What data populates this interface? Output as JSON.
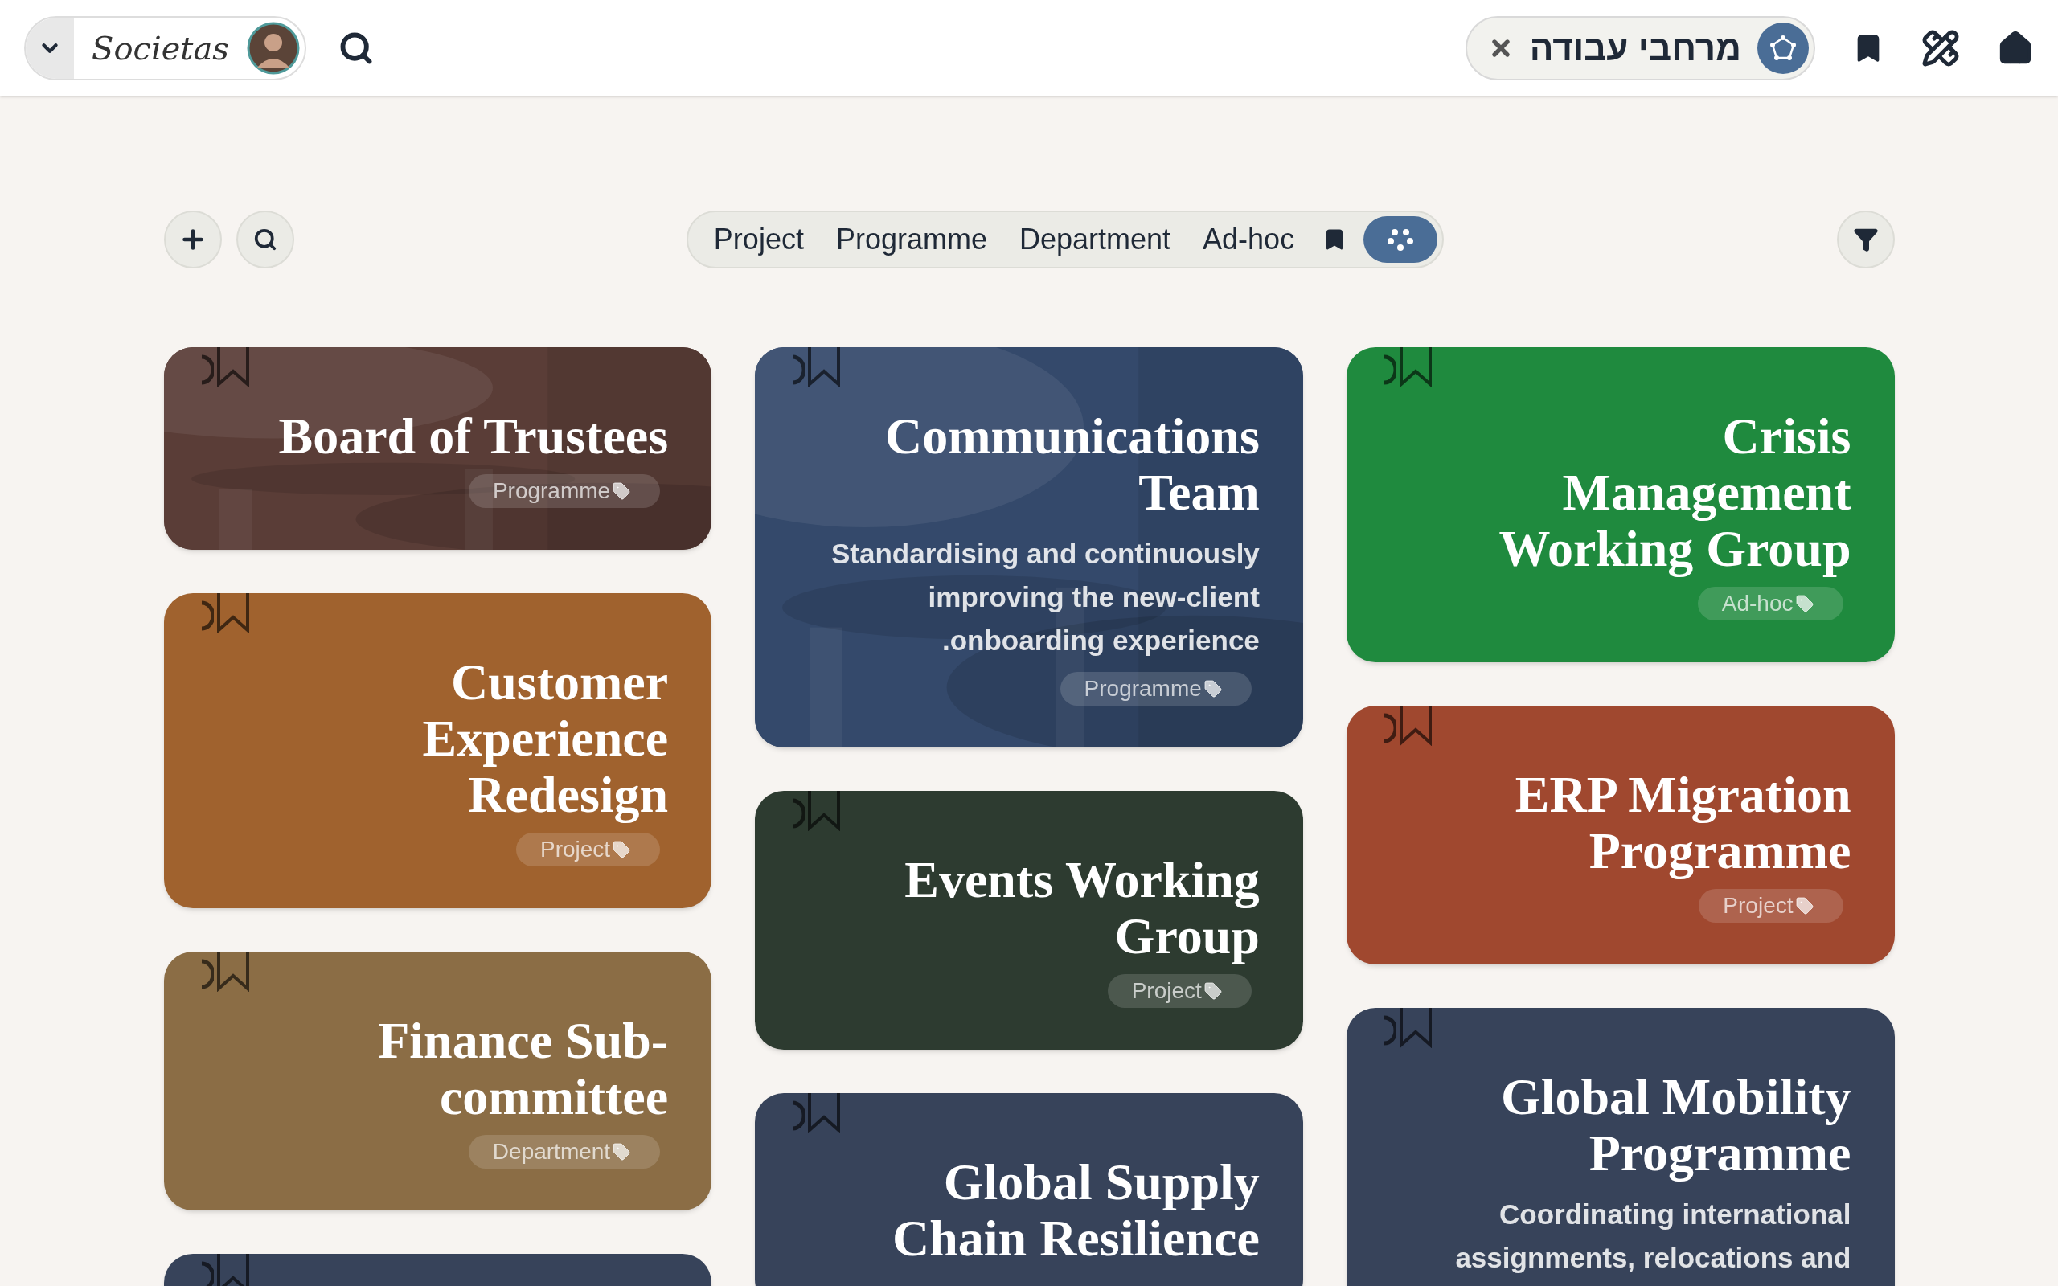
{
  "header": {
    "logo": "Societas",
    "workspace_chip": {
      "label": "מרחבי עבודה"
    }
  },
  "toolbar": {
    "segments": [
      {
        "kind": "text",
        "label": "Project",
        "selected": false
      },
      {
        "kind": "text",
        "label": "Programme",
        "selected": false
      },
      {
        "kind": "text",
        "label": "Department",
        "selected": false
      },
      {
        "kind": "text",
        "label": "Ad-hoc",
        "selected": false
      },
      {
        "kind": "bookmark",
        "selected": false
      },
      {
        "kind": "all",
        "selected": true
      }
    ]
  },
  "columns": [
    [
      {
        "title": "Board of Trustees",
        "tag": "Programme",
        "color": "#5a3d37",
        "kind": "picture"
      },
      {
        "title": "Customer Experience Redesign",
        "tag": "Project",
        "color": "#a0622e",
        "kind": "plain"
      },
      {
        "title": "Finance Sub-committee",
        "tag": "Department",
        "color": "#8b6d45",
        "kind": "plain"
      },
      {
        "color": "#37435a",
        "kind": "plain"
      }
    ],
    [
      {
        "title": "Communications Team",
        "description": "Standardising and continuously improving the new-client onboarding experience.",
        "tag": "Programme",
        "color": "#34496b",
        "kind": "picture"
      },
      {
        "title": "Events Working Group",
        "tag": "Project",
        "color": "#2d3b30",
        "kind": "plain"
      },
      {
        "title": "Global Supply Chain Resilience",
        "color": "#37435a",
        "kind": "plain"
      }
    ],
    [
      {
        "title": "Crisis Management Working Group",
        "tag": "Ad-hoc",
        "color": "#1f8a3e",
        "kind": "plain"
      },
      {
        "title": "ERP Migration Programme",
        "tag": "Project",
        "color": "#a0482f",
        "kind": "plain"
      },
      {
        "title": "Global Mobility Programme",
        "description": "Coordinating international assignments, relocations and",
        "color": "#37435a",
        "kind": "plain"
      }
    ]
  ]
}
